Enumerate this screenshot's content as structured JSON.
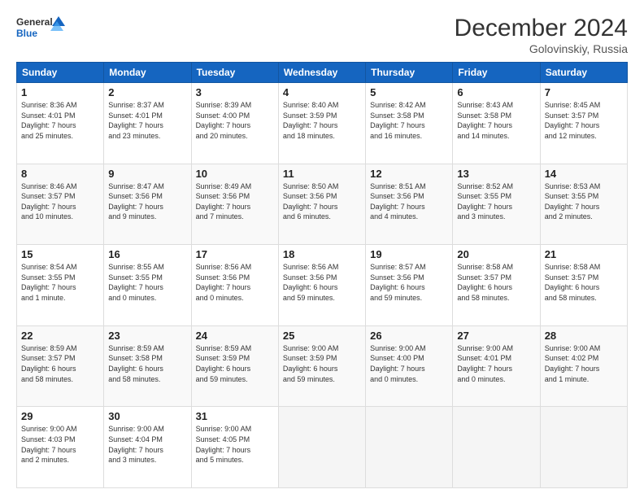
{
  "logo": {
    "line1": "General",
    "line2": "Blue"
  },
  "title": "December 2024",
  "location": "Golovinskiy, Russia",
  "weekdays": [
    "Sunday",
    "Monday",
    "Tuesday",
    "Wednesday",
    "Thursday",
    "Friday",
    "Saturday"
  ],
  "weeks": [
    [
      {
        "day": "1",
        "info": "Sunrise: 8:36 AM\nSunset: 4:01 PM\nDaylight: 7 hours\nand 25 minutes."
      },
      {
        "day": "2",
        "info": "Sunrise: 8:37 AM\nSunset: 4:01 PM\nDaylight: 7 hours\nand 23 minutes."
      },
      {
        "day": "3",
        "info": "Sunrise: 8:39 AM\nSunset: 4:00 PM\nDaylight: 7 hours\nand 20 minutes."
      },
      {
        "day": "4",
        "info": "Sunrise: 8:40 AM\nSunset: 3:59 PM\nDaylight: 7 hours\nand 18 minutes."
      },
      {
        "day": "5",
        "info": "Sunrise: 8:42 AM\nSunset: 3:58 PM\nDaylight: 7 hours\nand 16 minutes."
      },
      {
        "day": "6",
        "info": "Sunrise: 8:43 AM\nSunset: 3:58 PM\nDaylight: 7 hours\nand 14 minutes."
      },
      {
        "day": "7",
        "info": "Sunrise: 8:45 AM\nSunset: 3:57 PM\nDaylight: 7 hours\nand 12 minutes."
      }
    ],
    [
      {
        "day": "8",
        "info": "Sunrise: 8:46 AM\nSunset: 3:57 PM\nDaylight: 7 hours\nand 10 minutes."
      },
      {
        "day": "9",
        "info": "Sunrise: 8:47 AM\nSunset: 3:56 PM\nDaylight: 7 hours\nand 9 minutes."
      },
      {
        "day": "10",
        "info": "Sunrise: 8:49 AM\nSunset: 3:56 PM\nDaylight: 7 hours\nand 7 minutes."
      },
      {
        "day": "11",
        "info": "Sunrise: 8:50 AM\nSunset: 3:56 PM\nDaylight: 7 hours\nand 6 minutes."
      },
      {
        "day": "12",
        "info": "Sunrise: 8:51 AM\nSunset: 3:56 PM\nDaylight: 7 hours\nand 4 minutes."
      },
      {
        "day": "13",
        "info": "Sunrise: 8:52 AM\nSunset: 3:55 PM\nDaylight: 7 hours\nand 3 minutes."
      },
      {
        "day": "14",
        "info": "Sunrise: 8:53 AM\nSunset: 3:55 PM\nDaylight: 7 hours\nand 2 minutes."
      }
    ],
    [
      {
        "day": "15",
        "info": "Sunrise: 8:54 AM\nSunset: 3:55 PM\nDaylight: 7 hours\nand 1 minute."
      },
      {
        "day": "16",
        "info": "Sunrise: 8:55 AM\nSunset: 3:55 PM\nDaylight: 7 hours\nand 0 minutes."
      },
      {
        "day": "17",
        "info": "Sunrise: 8:56 AM\nSunset: 3:56 PM\nDaylight: 7 hours\nand 0 minutes."
      },
      {
        "day": "18",
        "info": "Sunrise: 8:56 AM\nSunset: 3:56 PM\nDaylight: 6 hours\nand 59 minutes."
      },
      {
        "day": "19",
        "info": "Sunrise: 8:57 AM\nSunset: 3:56 PM\nDaylight: 6 hours\nand 59 minutes."
      },
      {
        "day": "20",
        "info": "Sunrise: 8:58 AM\nSunset: 3:57 PM\nDaylight: 6 hours\nand 58 minutes."
      },
      {
        "day": "21",
        "info": "Sunrise: 8:58 AM\nSunset: 3:57 PM\nDaylight: 6 hours\nand 58 minutes."
      }
    ],
    [
      {
        "day": "22",
        "info": "Sunrise: 8:59 AM\nSunset: 3:57 PM\nDaylight: 6 hours\nand 58 minutes."
      },
      {
        "day": "23",
        "info": "Sunrise: 8:59 AM\nSunset: 3:58 PM\nDaylight: 6 hours\nand 58 minutes."
      },
      {
        "day": "24",
        "info": "Sunrise: 8:59 AM\nSunset: 3:59 PM\nDaylight: 6 hours\nand 59 minutes."
      },
      {
        "day": "25",
        "info": "Sunrise: 9:00 AM\nSunset: 3:59 PM\nDaylight: 6 hours\nand 59 minutes."
      },
      {
        "day": "26",
        "info": "Sunrise: 9:00 AM\nSunset: 4:00 PM\nDaylight: 7 hours\nand 0 minutes."
      },
      {
        "day": "27",
        "info": "Sunrise: 9:00 AM\nSunset: 4:01 PM\nDaylight: 7 hours\nand 0 minutes."
      },
      {
        "day": "28",
        "info": "Sunrise: 9:00 AM\nSunset: 4:02 PM\nDaylight: 7 hours\nand 1 minute."
      }
    ],
    [
      {
        "day": "29",
        "info": "Sunrise: 9:00 AM\nSunset: 4:03 PM\nDaylight: 7 hours\nand 2 minutes."
      },
      {
        "day": "30",
        "info": "Sunrise: 9:00 AM\nSunset: 4:04 PM\nDaylight: 7 hours\nand 3 minutes."
      },
      {
        "day": "31",
        "info": "Sunrise: 9:00 AM\nSunset: 4:05 PM\nDaylight: 7 hours\nand 5 minutes."
      },
      {
        "day": "",
        "info": ""
      },
      {
        "day": "",
        "info": ""
      },
      {
        "day": "",
        "info": ""
      },
      {
        "day": "",
        "info": ""
      }
    ]
  ]
}
